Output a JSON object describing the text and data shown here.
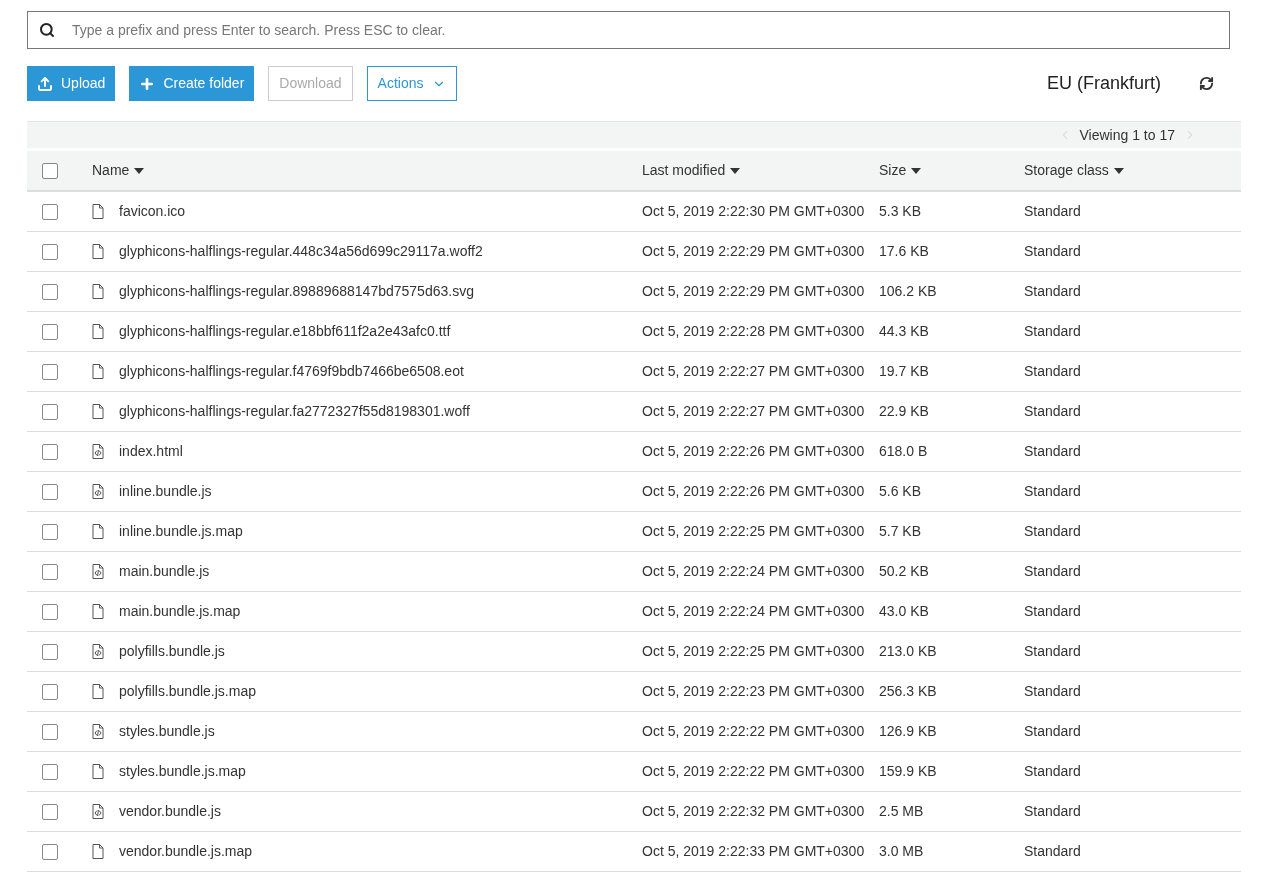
{
  "search": {
    "placeholder": "Type a prefix and press Enter to search. Press ESC to clear."
  },
  "toolbar": [
    {
      "kind": "upload",
      "label": "Upload",
      "disabled": false
    },
    {
      "kind": "create",
      "label": "Create folder",
      "disabled": false
    },
    {
      "kind": "plain",
      "label": "Download",
      "disabled": true
    },
    {
      "kind": "menu",
      "label": "Actions",
      "disabled": false
    }
  ],
  "region": "EU (Frankfurt)",
  "pager": {
    "text": "Viewing 1 to 17"
  },
  "table": {
    "select_all": {
      "checked": false
    },
    "columns": [
      "Name",
      "Last modified",
      "Size",
      "Storage class"
    ],
    "rows": [
      {
        "kind": "file",
        "checked": false,
        "name": "favicon.ico",
        "modified": "Oct 5, 2019 2:22:30 PM GMT+0300",
        "size": "5.3 KB",
        "storage": "Standard"
      },
      {
        "kind": "file",
        "checked": false,
        "name": "glyphicons-halflings-regular.448c34a56d699c29117a.woff2",
        "modified": "Oct 5, 2019 2:22:29 PM GMT+0300",
        "size": "17.6 KB",
        "storage": "Standard"
      },
      {
        "kind": "file",
        "checked": false,
        "name": "glyphicons-halflings-regular.89889688147bd7575d63.svg",
        "modified": "Oct 5, 2019 2:22:29 PM GMT+0300",
        "size": "106.2 KB",
        "storage": "Standard"
      },
      {
        "kind": "file",
        "checked": false,
        "name": "glyphicons-halflings-regular.e18bbf611f2a2e43afc0.ttf",
        "modified": "Oct 5, 2019 2:22:28 PM GMT+0300",
        "size": "44.3 KB",
        "storage": "Standard"
      },
      {
        "kind": "file",
        "checked": false,
        "name": "glyphicons-halflings-regular.f4769f9bdb7466be6508.eot",
        "modified": "Oct 5, 2019 2:22:27 PM GMT+0300",
        "size": "19.7 KB",
        "storage": "Standard"
      },
      {
        "kind": "file",
        "checked": false,
        "name": "glyphicons-halflings-regular.fa2772327f55d8198301.woff",
        "modified": "Oct 5, 2019 2:22:27 PM GMT+0300",
        "size": "22.9 KB",
        "storage": "Standard"
      },
      {
        "kind": "code",
        "checked": false,
        "name": "index.html",
        "modified": "Oct 5, 2019 2:22:26 PM GMT+0300",
        "size": "618.0 B",
        "storage": "Standard"
      },
      {
        "kind": "code",
        "checked": false,
        "name": "inline.bundle.js",
        "modified": "Oct 5, 2019 2:22:26 PM GMT+0300",
        "size": "5.6 KB",
        "storage": "Standard"
      },
      {
        "kind": "file",
        "checked": false,
        "name": "inline.bundle.js.map",
        "modified": "Oct 5, 2019 2:22:25 PM GMT+0300",
        "size": "5.7 KB",
        "storage": "Standard"
      },
      {
        "kind": "code",
        "checked": false,
        "name": "main.bundle.js",
        "modified": "Oct 5, 2019 2:22:24 PM GMT+0300",
        "size": "50.2 KB",
        "storage": "Standard"
      },
      {
        "kind": "file",
        "checked": false,
        "name": "main.bundle.js.map",
        "modified": "Oct 5, 2019 2:22:24 PM GMT+0300",
        "size": "43.0 KB",
        "storage": "Standard"
      },
      {
        "kind": "code",
        "checked": false,
        "name": "polyfills.bundle.js",
        "modified": "Oct 5, 2019 2:22:25 PM GMT+0300",
        "size": "213.0 KB",
        "storage": "Standard"
      },
      {
        "kind": "file",
        "checked": false,
        "name": "polyfills.bundle.js.map",
        "modified": "Oct 5, 2019 2:22:23 PM GMT+0300",
        "size": "256.3 KB",
        "storage": "Standard"
      },
      {
        "kind": "code",
        "checked": false,
        "name": "styles.bundle.js",
        "modified": "Oct 5, 2019 2:22:22 PM GMT+0300",
        "size": "126.9 KB",
        "storage": "Standard"
      },
      {
        "kind": "file",
        "checked": false,
        "name": "styles.bundle.js.map",
        "modified": "Oct 5, 2019 2:22:22 PM GMT+0300",
        "size": "159.9 KB",
        "storage": "Standard"
      },
      {
        "kind": "code",
        "checked": false,
        "name": "vendor.bundle.js",
        "modified": "Oct 5, 2019 2:22:32 PM GMT+0300",
        "size": "2.5 MB",
        "storage": "Standard"
      },
      {
        "kind": "file",
        "checked": false,
        "name": "vendor.bundle.js.map",
        "modified": "Oct 5, 2019 2:22:33 PM GMT+0300",
        "size": "3.0 MB",
        "storage": "Standard"
      }
    ]
  }
}
